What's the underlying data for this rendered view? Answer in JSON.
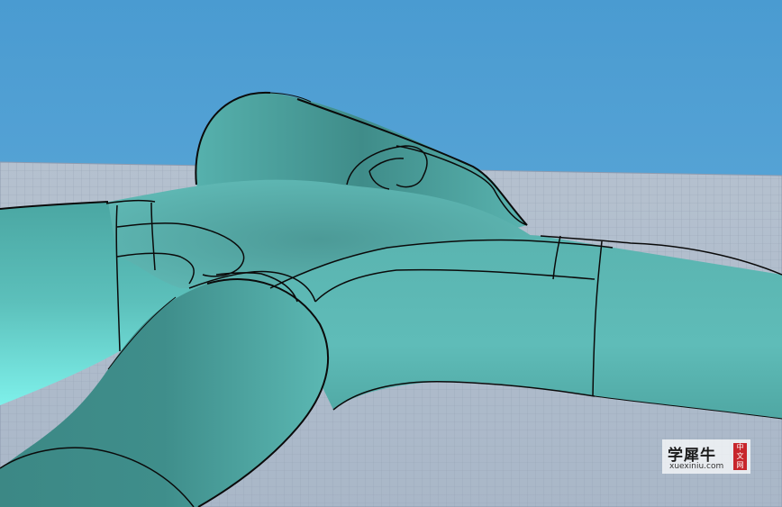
{
  "viewport": {
    "background_color": "#4f9fd3",
    "model_colors": [
      "#3f8f8c",
      "#5fbdb8",
      "#7be6e0",
      "#2a6a68"
    ],
    "edge_color": "#0a0a0a",
    "grid_color": "#aab6c8"
  },
  "watermark": {
    "brand_cn": "学犀牛",
    "url": "xuexiniu.com",
    "seal_text": "中文网"
  }
}
